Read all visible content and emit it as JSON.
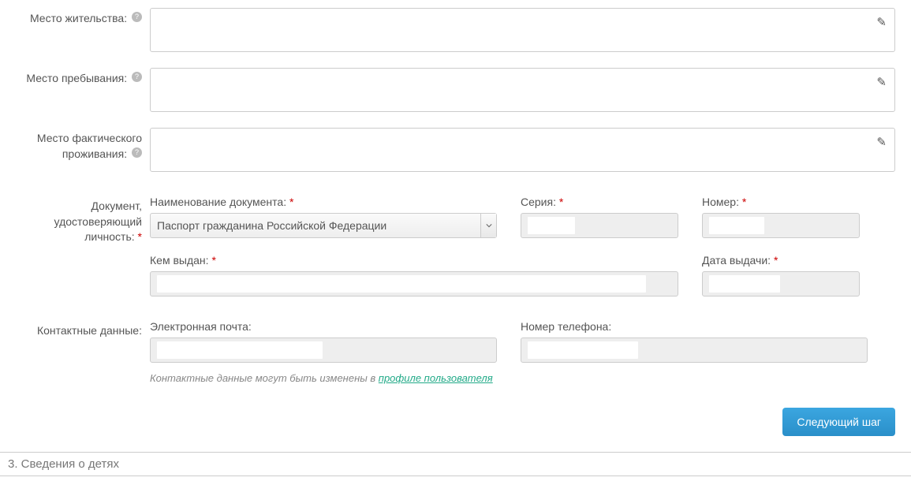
{
  "rows": {
    "residence": {
      "label": "Место жительства:"
    },
    "stay": {
      "label": "Место пребывания:"
    },
    "actual": {
      "label_line1": "Место фактического",
      "label_line2": "проживания:"
    },
    "document": {
      "label_line1": "Документ,",
      "label_line2": "удостоверяющий",
      "label_line3": "личность:",
      "doc_name_label": "Наименование документа:",
      "doc_name_value": "Паспорт гражданина Российской Федерации",
      "series_label": "Серия:",
      "number_label": "Номер:",
      "issued_by_label": "Кем выдан:",
      "issue_date_label": "Дата выдачи:"
    },
    "contacts": {
      "label": "Контактные данные:",
      "email_label": "Электронная почта:",
      "phone_label": "Номер телефона:",
      "note_prefix": "Контактные данные могут быть изменены в ",
      "note_link": "профиле пользователя"
    }
  },
  "buttons": {
    "next": "Следующий шаг"
  },
  "section3": "3. Сведения о детях"
}
